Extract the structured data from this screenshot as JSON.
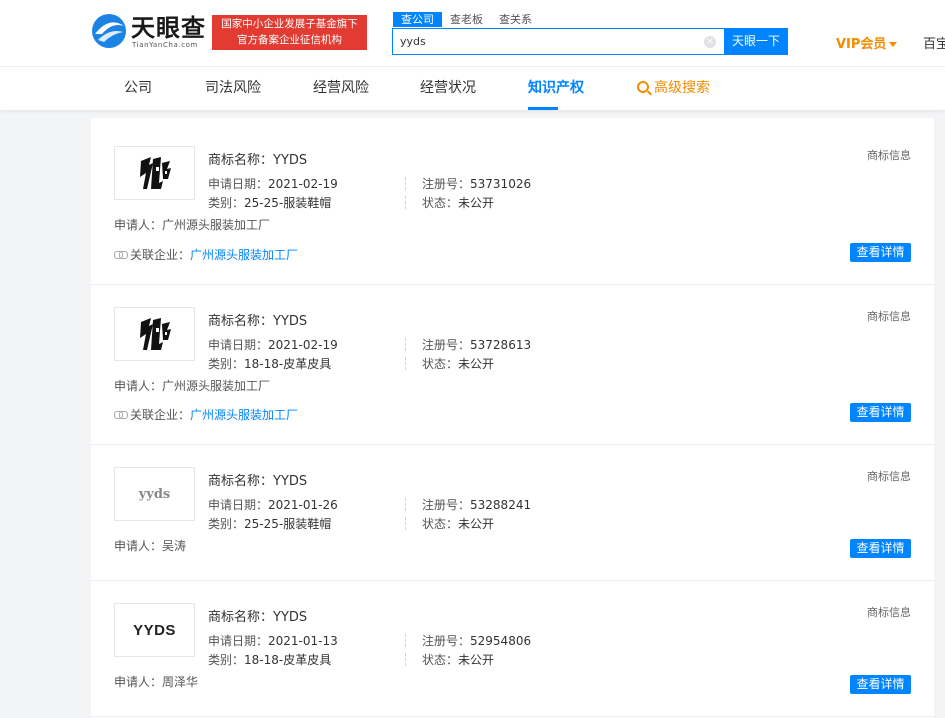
{
  "header": {
    "logo_title": "天眼查",
    "logo_sub": "TianYanCha.com",
    "promo_line1": "国家中小企业发展子基金旗下",
    "promo_line2": "官方备案企业征信机构",
    "search_tabs": [
      "查公司",
      "查老板",
      "查关系"
    ],
    "search_value": "yyds",
    "search_button": "天眼一下",
    "vip_label": "VIP会员",
    "right_cut_label": "百宝"
  },
  "nav": {
    "items": [
      "公司",
      "司法风险",
      "经营风险",
      "经营状况",
      "知识产权"
    ],
    "active_index": 4,
    "advanced_search": "高级搜索"
  },
  "labels": {
    "name": "商标名称：",
    "apply_date": "申请日期：",
    "category": "类别：",
    "reg_no": "注册号：",
    "status": "状态：",
    "applicant": "申请人：",
    "related": "关联企业：",
    "tag": "商标信息",
    "detail": "查看详情"
  },
  "results": [
    {
      "logo_type": "image",
      "name": "YYDS",
      "apply_date": "2021-02-19",
      "category": "25-25-服装鞋帽",
      "reg_no": "53731026",
      "status": "未公开",
      "applicant": "广州源头服装加工厂",
      "related": "广州源头服装加工厂"
    },
    {
      "logo_type": "image",
      "name": "YYDS",
      "apply_date": "2021-02-19",
      "category": "18-18-皮革皮具",
      "reg_no": "53728613",
      "status": "未公开",
      "applicant": "广州源头服装加工厂",
      "related": "广州源头服装加工厂"
    },
    {
      "logo_type": "text",
      "logo_text": "yyds",
      "name": "YYDS",
      "apply_date": "2021-01-26",
      "category": "25-25-服装鞋帽",
      "reg_no": "53288241",
      "status": "未公开",
      "applicant": "吴涛"
    },
    {
      "logo_type": "text",
      "logo_text": "YYDS",
      "name": "YYDS",
      "apply_date": "2021-01-13",
      "category": "18-18-皮革皮具",
      "reg_no": "52954806",
      "status": "未公开",
      "applicant": "周泽华"
    }
  ]
}
